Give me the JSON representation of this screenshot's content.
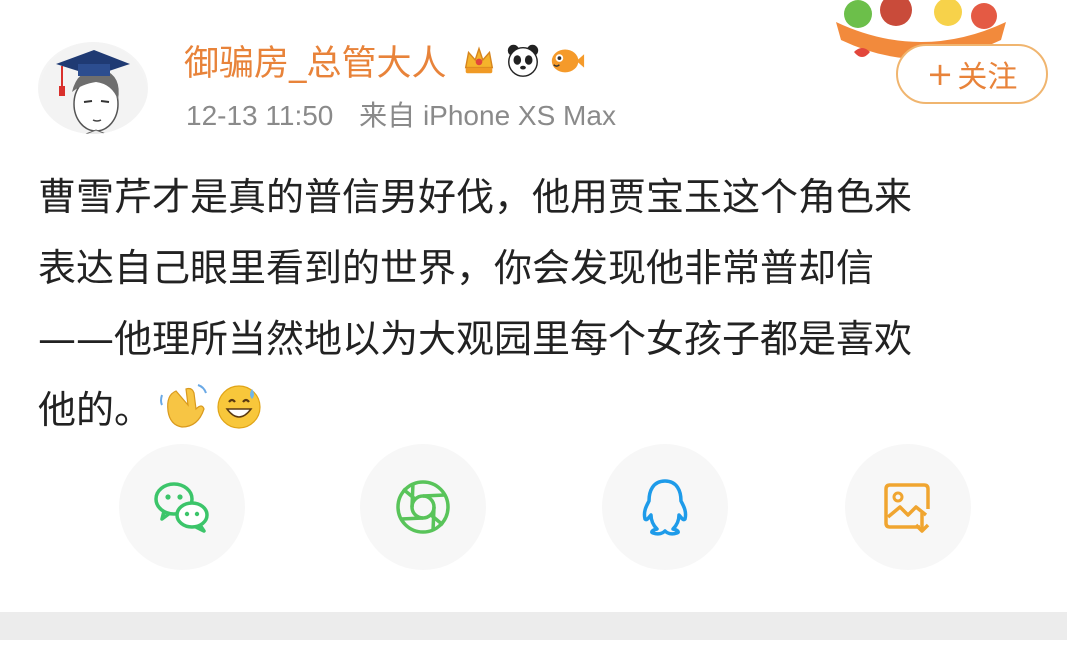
{
  "post": {
    "author": {
      "name": "御骗房_总管大人",
      "avatar_icon": "cartoon-boy-graduation-cap",
      "badges": [
        "crown-badge-icon",
        "panda-icon",
        "pufferfish-icon"
      ]
    },
    "time": "12-13 11:50",
    "source": "来自 iPhone XS Max",
    "follow_label": "关注",
    "follow_plus": "+",
    "text_lines": [
      "曹雪芹才是真的普信男好伐，他用贾宝玉这个角色来",
      "表达自己眼里看到的世界，你会发现他非常普却信",
      "——他理所当然地以为大观园里每个女孩子都是喜欢",
      "他的。"
    ],
    "emojis": [
      "waving-hand-icon",
      "grinning-sweat-icon"
    ]
  },
  "share": {
    "items": [
      {
        "name": "wechat-share-button",
        "icon": "wechat-icon",
        "color": "#3cc56a"
      },
      {
        "name": "moments-share-button",
        "icon": "moments-aperture-icon",
        "color": "#59c45a"
      },
      {
        "name": "qq-share-button",
        "icon": "qq-penguin-icon",
        "color": "#1e9be9"
      },
      {
        "name": "save-image-button",
        "icon": "save-image-icon",
        "color": "#f0a530"
      }
    ]
  },
  "colors": {
    "accent": "#e8833a",
    "meta": "#8a8a8a",
    "text": "#222222",
    "follow_border": "#f0b56f"
  }
}
